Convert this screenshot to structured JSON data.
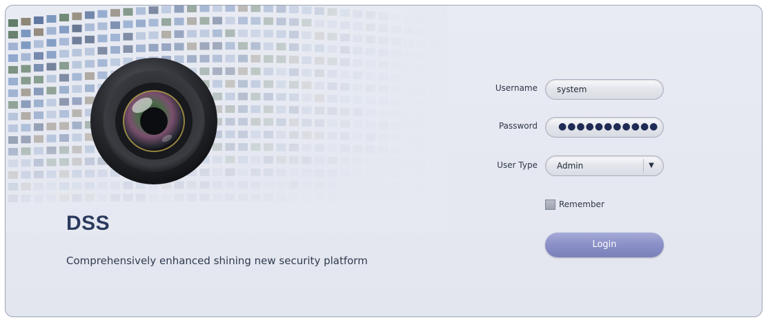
{
  "brand": {
    "name": "DSS",
    "tagline": "Comprehensively enhanced shining new security platform"
  },
  "form": {
    "username": {
      "label": "Username",
      "value": "system"
    },
    "password": {
      "label": "Password",
      "masked_value": "●●●●●●●●●●●"
    },
    "user_type": {
      "label": "User Type",
      "selected": "Admin",
      "arrow": "▼"
    },
    "remember": {
      "label": "Remember",
      "checked": false
    },
    "login_label": "Login"
  },
  "colors": {
    "brand_text": "#2b3a5e",
    "button": "#8a8fc6",
    "background": "#e6e9f1"
  },
  "icons": {
    "lens": "camera-lens-icon",
    "dropdown": "chevron-down-icon"
  }
}
